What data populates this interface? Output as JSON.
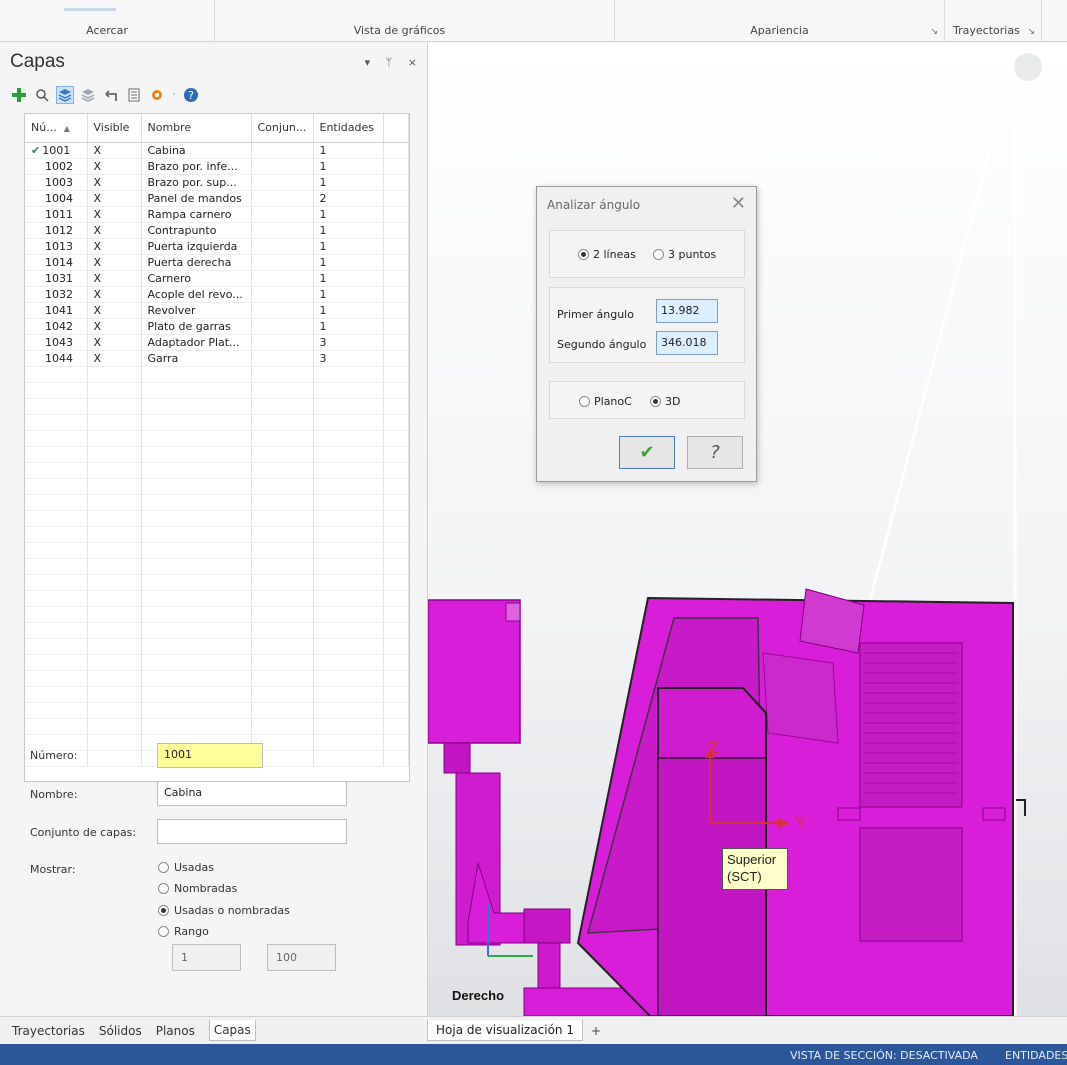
{
  "ribbon": {
    "groups": [
      "Acercar",
      "Vista de gráficos",
      "Apariencia",
      "Trayectorias"
    ],
    "launcher_glyph": "↘"
  },
  "panel": {
    "title": "Capas",
    "pin_glyph": "▾",
    "dock_glyph": "ᛘ",
    "close_glyph": "×"
  },
  "grid": {
    "headers": [
      "Nú...",
      "Visible",
      "Nombre",
      "Conjun...",
      "Entidades"
    ],
    "sort_glyph": "▲",
    "current_mark": "✔",
    "rows": [
      {
        "num": "1001",
        "visible": "X",
        "name": "Cabina",
        "set": "",
        "ent": "1"
      },
      {
        "num": "1002",
        "visible": "X",
        "name": "Brazo por. infe...",
        "set": "",
        "ent": "1"
      },
      {
        "num": "1003",
        "visible": "X",
        "name": "Brazo por. sup...",
        "set": "",
        "ent": "1"
      },
      {
        "num": "1004",
        "visible": "X",
        "name": "Panel de mandos",
        "set": "",
        "ent": "2"
      },
      {
        "num": "1011",
        "visible": "X",
        "name": "Rampa carnero",
        "set": "",
        "ent": "1"
      },
      {
        "num": "1012",
        "visible": "X",
        "name": "Contrapunto",
        "set": "",
        "ent": "1"
      },
      {
        "num": "1013",
        "visible": "X",
        "name": "Puerta izquierda",
        "set": "",
        "ent": "1"
      },
      {
        "num": "1014",
        "visible": "X",
        "name": "Puerta derecha",
        "set": "",
        "ent": "1"
      },
      {
        "num": "1031",
        "visible": "X",
        "name": "Carnero",
        "set": "",
        "ent": "1"
      },
      {
        "num": "1032",
        "visible": "X",
        "name": "Acople del revo...",
        "set": "",
        "ent": "1"
      },
      {
        "num": "1041",
        "visible": "X",
        "name": "Revolver",
        "set": "",
        "ent": "1"
      },
      {
        "num": "1042",
        "visible": "X",
        "name": "Plato de garras",
        "set": "",
        "ent": "1"
      },
      {
        "num": "1043",
        "visible": "X",
        "name": "Adaptador Plat...",
        "set": "",
        "ent": "3"
      },
      {
        "num": "1044",
        "visible": "X",
        "name": "Garra",
        "set": "",
        "ent": "3"
      }
    ]
  },
  "form": {
    "numero_label": "Número:",
    "numero_value": "1001",
    "nombre_label": "Nombre:",
    "nombre_value": "Cabina",
    "conjunto_label": "Conjunto de capas:",
    "conjunto_value": "",
    "mostrar_label": "Mostrar:",
    "mostrar_options": [
      "Usadas",
      "Nombradas",
      "Usadas o nombradas",
      "Rango"
    ],
    "mostrar_selected": "Usadas o nombradas",
    "range_from": "1",
    "range_to": "100"
  },
  "panel_tabs": [
    "Trayectorias",
    "Sólidos",
    "Planos",
    "Capas"
  ],
  "panel_tab_selected": "Capas",
  "dialog": {
    "title": "Analizar ángulo",
    "close_glyph": "✕",
    "mode_options": [
      "2 líneas",
      "3 puntos"
    ],
    "mode_selected": "2 líneas",
    "primer_label": "Primer ángulo",
    "primer_value": "13.982",
    "segundo_label": "Segundo ángulo",
    "segundo_value": "346.018",
    "plane_options": [
      "PlanoC",
      "3D"
    ],
    "plane_selected": "3D",
    "ok_glyph": "✔",
    "help_glyph": "?"
  },
  "viewport": {
    "view_name": "Derecho",
    "axis_label_line1": "Superior",
    "axis_label_line2": "(SCT)",
    "axis_z": "Z",
    "axis_y": "Y",
    "model_color": "#d81ed8",
    "model_dark": "#a010a0"
  },
  "doc_tabs": {
    "tab": "Hoja de visualización 1",
    "add": "+"
  },
  "status": {
    "section_view": "VISTA DE SECCIÓN: DESACTIVADA",
    "entities": "ENTIDADES"
  },
  "colors": {
    "status_bar": "#2b579a",
    "selected_number_field": "#ffff99",
    "dialog_field": "#ddeeff"
  }
}
